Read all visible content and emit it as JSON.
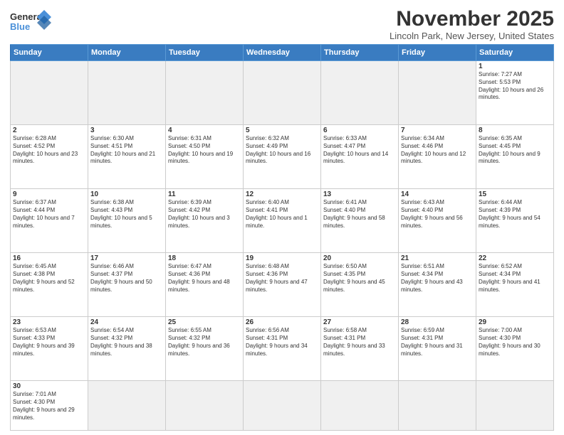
{
  "header": {
    "logo_general": "General",
    "logo_blue": "Blue",
    "month_title": "November 2025",
    "location": "Lincoln Park, New Jersey, United States"
  },
  "weekdays": [
    "Sunday",
    "Monday",
    "Tuesday",
    "Wednesday",
    "Thursday",
    "Friday",
    "Saturday"
  ],
  "weeks": [
    [
      {
        "day": "",
        "info": ""
      },
      {
        "day": "",
        "info": ""
      },
      {
        "day": "",
        "info": ""
      },
      {
        "day": "",
        "info": ""
      },
      {
        "day": "",
        "info": ""
      },
      {
        "day": "",
        "info": ""
      },
      {
        "day": "1",
        "info": "Sunrise: 7:27 AM\nSunset: 5:53 PM\nDaylight: 10 hours and 26 minutes."
      }
    ],
    [
      {
        "day": "2",
        "info": "Sunrise: 6:28 AM\nSunset: 4:52 PM\nDaylight: 10 hours and 23 minutes."
      },
      {
        "day": "3",
        "info": "Sunrise: 6:30 AM\nSunset: 4:51 PM\nDaylight: 10 hours and 21 minutes."
      },
      {
        "day": "4",
        "info": "Sunrise: 6:31 AM\nSunset: 4:50 PM\nDaylight: 10 hours and 19 minutes."
      },
      {
        "day": "5",
        "info": "Sunrise: 6:32 AM\nSunset: 4:49 PM\nDaylight: 10 hours and 16 minutes."
      },
      {
        "day": "6",
        "info": "Sunrise: 6:33 AM\nSunset: 4:47 PM\nDaylight: 10 hours and 14 minutes."
      },
      {
        "day": "7",
        "info": "Sunrise: 6:34 AM\nSunset: 4:46 PM\nDaylight: 10 hours and 12 minutes."
      },
      {
        "day": "8",
        "info": "Sunrise: 6:35 AM\nSunset: 4:45 PM\nDaylight: 10 hours and 9 minutes."
      }
    ],
    [
      {
        "day": "9",
        "info": "Sunrise: 6:37 AM\nSunset: 4:44 PM\nDaylight: 10 hours and 7 minutes."
      },
      {
        "day": "10",
        "info": "Sunrise: 6:38 AM\nSunset: 4:43 PM\nDaylight: 10 hours and 5 minutes."
      },
      {
        "day": "11",
        "info": "Sunrise: 6:39 AM\nSunset: 4:42 PM\nDaylight: 10 hours and 3 minutes."
      },
      {
        "day": "12",
        "info": "Sunrise: 6:40 AM\nSunset: 4:41 PM\nDaylight: 10 hours and 1 minute."
      },
      {
        "day": "13",
        "info": "Sunrise: 6:41 AM\nSunset: 4:40 PM\nDaylight: 9 hours and 58 minutes."
      },
      {
        "day": "14",
        "info": "Sunrise: 6:43 AM\nSunset: 4:40 PM\nDaylight: 9 hours and 56 minutes."
      },
      {
        "day": "15",
        "info": "Sunrise: 6:44 AM\nSunset: 4:39 PM\nDaylight: 9 hours and 54 minutes."
      }
    ],
    [
      {
        "day": "16",
        "info": "Sunrise: 6:45 AM\nSunset: 4:38 PM\nDaylight: 9 hours and 52 minutes."
      },
      {
        "day": "17",
        "info": "Sunrise: 6:46 AM\nSunset: 4:37 PM\nDaylight: 9 hours and 50 minutes."
      },
      {
        "day": "18",
        "info": "Sunrise: 6:47 AM\nSunset: 4:36 PM\nDaylight: 9 hours and 48 minutes."
      },
      {
        "day": "19",
        "info": "Sunrise: 6:48 AM\nSunset: 4:36 PM\nDaylight: 9 hours and 47 minutes."
      },
      {
        "day": "20",
        "info": "Sunrise: 6:50 AM\nSunset: 4:35 PM\nDaylight: 9 hours and 45 minutes."
      },
      {
        "day": "21",
        "info": "Sunrise: 6:51 AM\nSunset: 4:34 PM\nDaylight: 9 hours and 43 minutes."
      },
      {
        "day": "22",
        "info": "Sunrise: 6:52 AM\nSunset: 4:34 PM\nDaylight: 9 hours and 41 minutes."
      }
    ],
    [
      {
        "day": "23",
        "info": "Sunrise: 6:53 AM\nSunset: 4:33 PM\nDaylight: 9 hours and 39 minutes."
      },
      {
        "day": "24",
        "info": "Sunrise: 6:54 AM\nSunset: 4:32 PM\nDaylight: 9 hours and 38 minutes."
      },
      {
        "day": "25",
        "info": "Sunrise: 6:55 AM\nSunset: 4:32 PM\nDaylight: 9 hours and 36 minutes."
      },
      {
        "day": "26",
        "info": "Sunrise: 6:56 AM\nSunset: 4:31 PM\nDaylight: 9 hours and 34 minutes."
      },
      {
        "day": "27",
        "info": "Sunrise: 6:58 AM\nSunset: 4:31 PM\nDaylight: 9 hours and 33 minutes."
      },
      {
        "day": "28",
        "info": "Sunrise: 6:59 AM\nSunset: 4:31 PM\nDaylight: 9 hours and 31 minutes."
      },
      {
        "day": "29",
        "info": "Sunrise: 7:00 AM\nSunset: 4:30 PM\nDaylight: 9 hours and 30 minutes."
      }
    ],
    [
      {
        "day": "30",
        "info": "Sunrise: 7:01 AM\nSunset: 4:30 PM\nDaylight: 9 hours and 29 minutes."
      },
      {
        "day": "",
        "info": ""
      },
      {
        "day": "",
        "info": ""
      },
      {
        "day": "",
        "info": ""
      },
      {
        "day": "",
        "info": ""
      },
      {
        "day": "",
        "info": ""
      },
      {
        "day": "",
        "info": ""
      }
    ]
  ]
}
